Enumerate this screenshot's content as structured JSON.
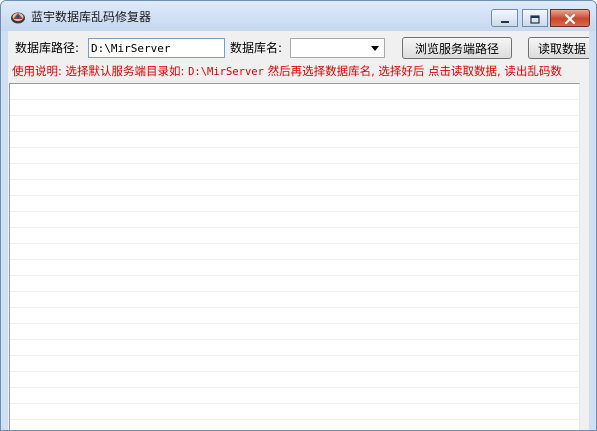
{
  "window": {
    "title": "蓝宇数据库乱码修复器"
  },
  "form": {
    "path_label": "数据库路径:",
    "path_value": "D:\\MirServer",
    "dbname_label": "数据库名:",
    "dbname_value": "",
    "browse_button": "浏览服务端路径",
    "read_button": "读取数据"
  },
  "instructions": {
    "part1": "使用说明: 选择默认服务端目录如: ",
    "path": "D:\\MirServer",
    "part2": "  然后再选择数据库名, 选择好后 点击读取数据, 读出乱码数"
  },
  "colors": {
    "instruction_text": "#e10000",
    "window_frame": "#cfe0f3",
    "close_button": "#c7472a"
  },
  "icons": {
    "app": "app-logo-icon",
    "minimize": "minimize-icon",
    "maximize": "maximize-icon",
    "close": "close-icon",
    "dropdown": "chevron-down-icon"
  }
}
